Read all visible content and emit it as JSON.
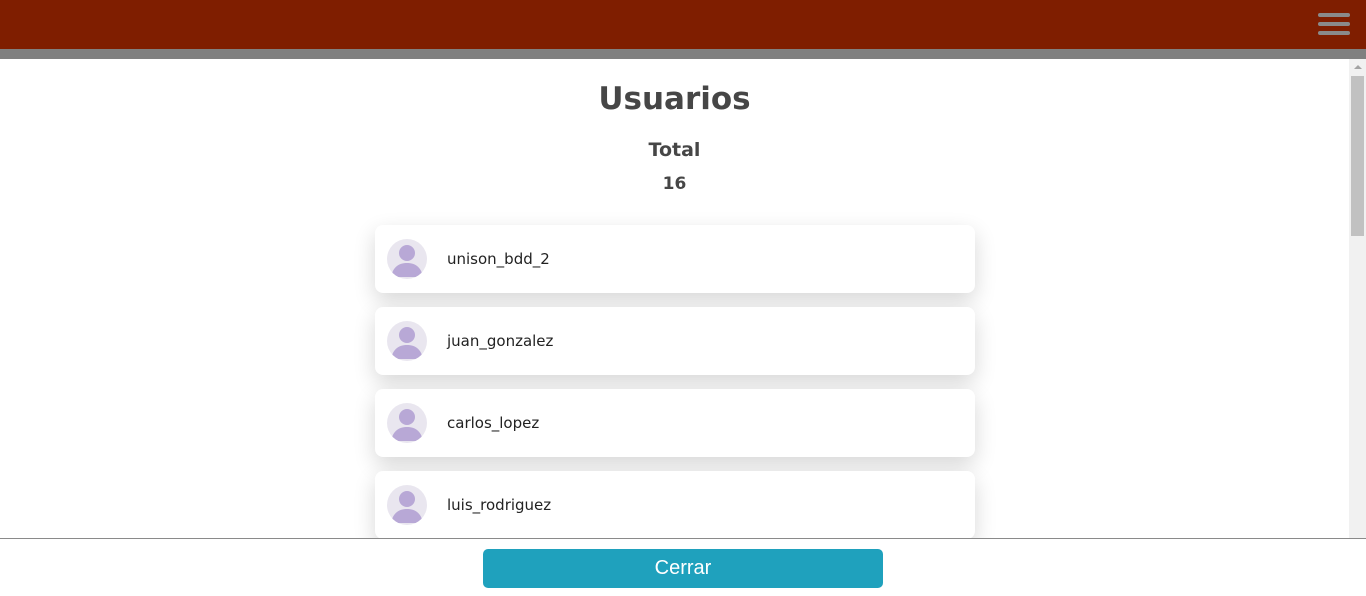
{
  "header": {
    "menu_icon": "hamburger-menu-icon",
    "bar_color": "#7f1e00"
  },
  "main": {
    "title": "Usuarios",
    "total_label": "Total",
    "total_value": "16"
  },
  "users": [
    {
      "name": "unison_bdd_2",
      "icon": "user-avatar-icon"
    },
    {
      "name": "juan_gonzalez",
      "icon": "user-avatar-icon"
    },
    {
      "name": "carlos_lopez",
      "icon": "user-avatar-icon"
    },
    {
      "name": "luis_rodriguez",
      "icon": "user-avatar-icon"
    }
  ],
  "footer": {
    "close_label": "Cerrar",
    "button_color": "#1fa1bd"
  }
}
